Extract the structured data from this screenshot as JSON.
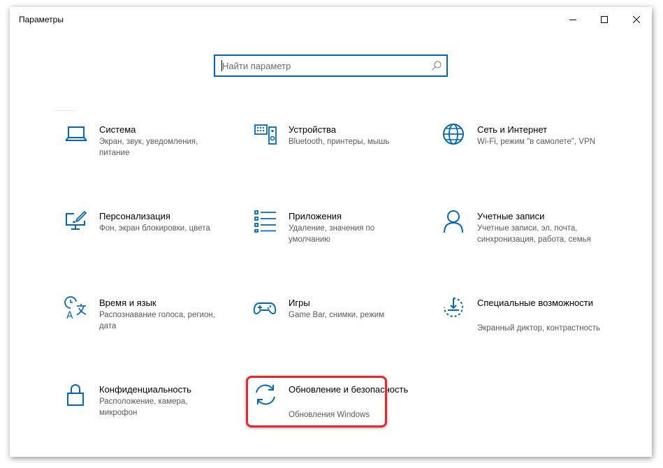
{
  "window": {
    "title": "Параметры"
  },
  "search": {
    "placeholder": "Найти параметр",
    "value": ""
  },
  "accent_color": "#0067c0",
  "highlight_color": "#e8262b",
  "categories": [
    {
      "name": "Система",
      "desc": "Экран, звук, уведомления, питание",
      "icon": "laptop-icon"
    },
    {
      "name": "Устройства",
      "desc": "Bluetooth, принтеры, мышь",
      "icon": "devices-icon"
    },
    {
      "name": "Сеть и Интернет",
      "desc": "Wi-Fi, режим \"в самолете\", VPN",
      "icon": "globe-icon"
    },
    {
      "name": "Персонализация",
      "desc": "Фон, экран блокировки, цвета",
      "icon": "personalization-icon"
    },
    {
      "name": "Приложения",
      "desc": "Удаление, значения по умолчанию",
      "icon": "apps-list-icon"
    },
    {
      "name": "Учетные записи",
      "desc": "Учетные записи, эл. почта, синхронизация, работа, семья",
      "icon": "person-icon"
    },
    {
      "name": "Время и язык",
      "desc": "Распознавание голоса, регион, дата",
      "icon": "time-language-icon"
    },
    {
      "name": "Игры",
      "desc": "Game Bar, снимки, режим",
      "icon": "gamepad-icon"
    },
    {
      "name": "Специальные возможности",
      "desc": "Экранный диктор, контрастность",
      "icon": "accessibility-icon"
    },
    {
      "name": "Конфиденциальность",
      "desc": "Расположение, камера, микрофон",
      "icon": "lock-icon"
    },
    {
      "name": "Обновление и безопасность",
      "desc": "Обновления Windows",
      "icon": "sync-icon"
    }
  ]
}
